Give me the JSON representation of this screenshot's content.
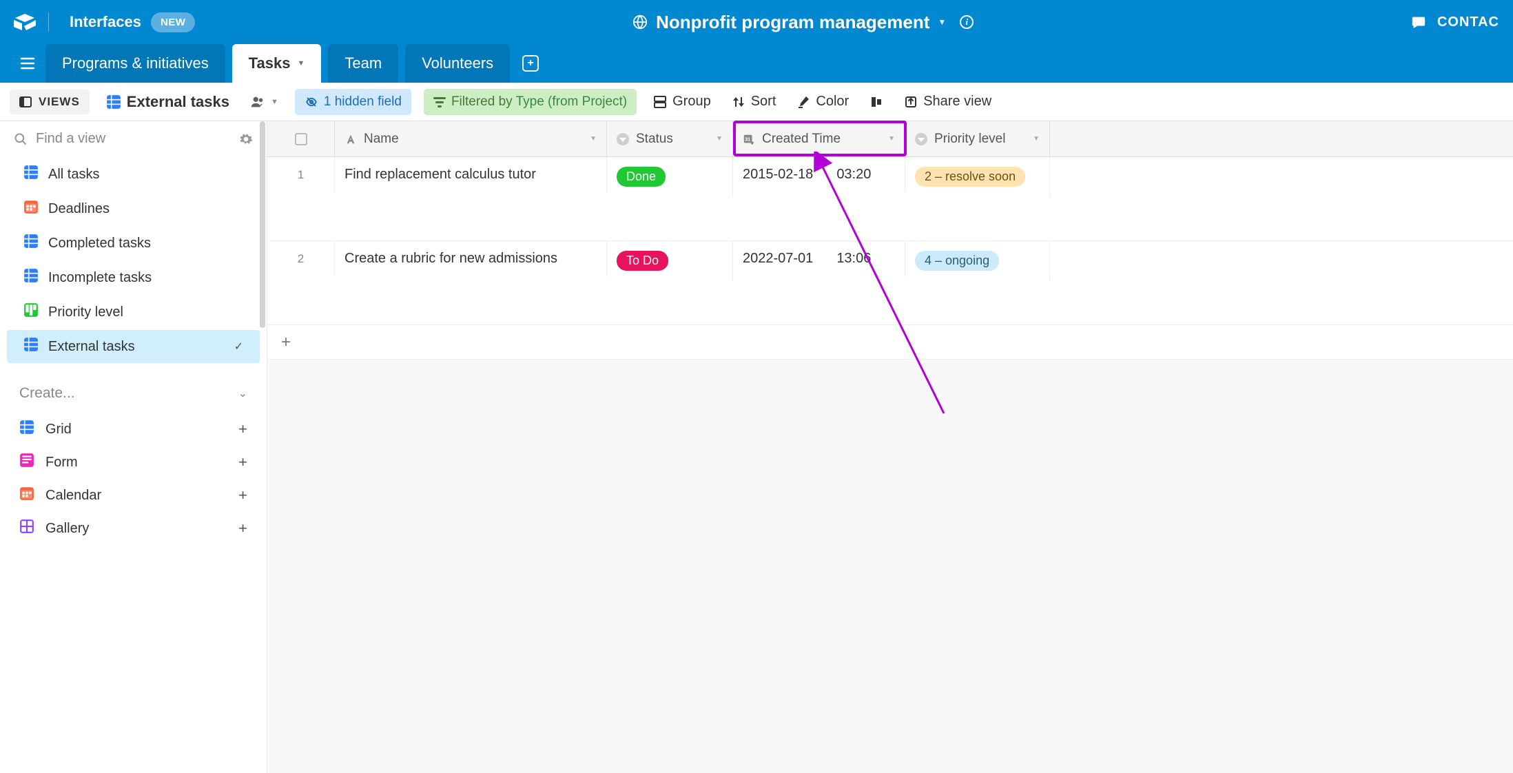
{
  "header": {
    "interfaces_label": "Interfaces",
    "new_badge": "NEW",
    "base_title": "Nonprofit program management",
    "contact_label": "CONTAC"
  },
  "tabs": [
    {
      "label": "Programs & initiatives",
      "active": false
    },
    {
      "label": "Tasks",
      "active": true
    },
    {
      "label": "Team",
      "active": false
    },
    {
      "label": "Volunteers",
      "active": false
    }
  ],
  "toolbar": {
    "views_label": "VIEWS",
    "view_name": "External tasks",
    "hidden_fields": "1 hidden field",
    "filter_prefix": "Filtered by ",
    "filter_field": "Type (from Project)",
    "group": "Group",
    "sort": "Sort",
    "color": "Color",
    "share": "Share view"
  },
  "sidebar": {
    "search_placeholder": "Find a view",
    "items": [
      {
        "label": "All tasks",
        "icon": "grid",
        "color": "#2d7ff9"
      },
      {
        "label": "Deadlines",
        "icon": "calendar",
        "color": "#f7653b"
      },
      {
        "label": "Completed tasks",
        "icon": "grid",
        "color": "#2d7ff9"
      },
      {
        "label": "Incomplete tasks",
        "icon": "grid",
        "color": "#2d7ff9"
      },
      {
        "label": "Priority level",
        "icon": "kanban",
        "color": "#20c933"
      },
      {
        "label": "External tasks",
        "icon": "grid",
        "color": "#2d7ff9",
        "active": true
      }
    ],
    "create_label": "Create...",
    "create_items": [
      {
        "label": "Grid",
        "icon": "grid",
        "color": "#2d7ff9"
      },
      {
        "label": "Form",
        "icon": "form",
        "color": "#e929ba"
      },
      {
        "label": "Calendar",
        "icon": "calendar",
        "color": "#f7653b"
      },
      {
        "label": "Gallery",
        "icon": "gallery",
        "color": "#8b46ff"
      }
    ]
  },
  "grid": {
    "columns": [
      {
        "label": "Name",
        "type": "text"
      },
      {
        "label": "Status",
        "type": "select"
      },
      {
        "label": "Created Time",
        "type": "created"
      },
      {
        "label": "Priority level",
        "type": "select"
      }
    ],
    "rows": [
      {
        "num": "1",
        "name": "Find replacement calculus tutor",
        "status": {
          "label": "Done",
          "class": "status-done"
        },
        "created_date": "2015-02-18",
        "created_time": "03:20",
        "priority": {
          "label": "2 – resolve soon",
          "class": "prio-2"
        }
      },
      {
        "num": "2",
        "name": "Create a rubric for new admissions",
        "status": {
          "label": "To Do",
          "class": "status-todo"
        },
        "created_date": "2022-07-01",
        "created_time": "13:06",
        "priority": {
          "label": "4 – ongoing",
          "class": "prio-4"
        }
      }
    ]
  },
  "annotation": {
    "highlight_column": "Created Time"
  }
}
